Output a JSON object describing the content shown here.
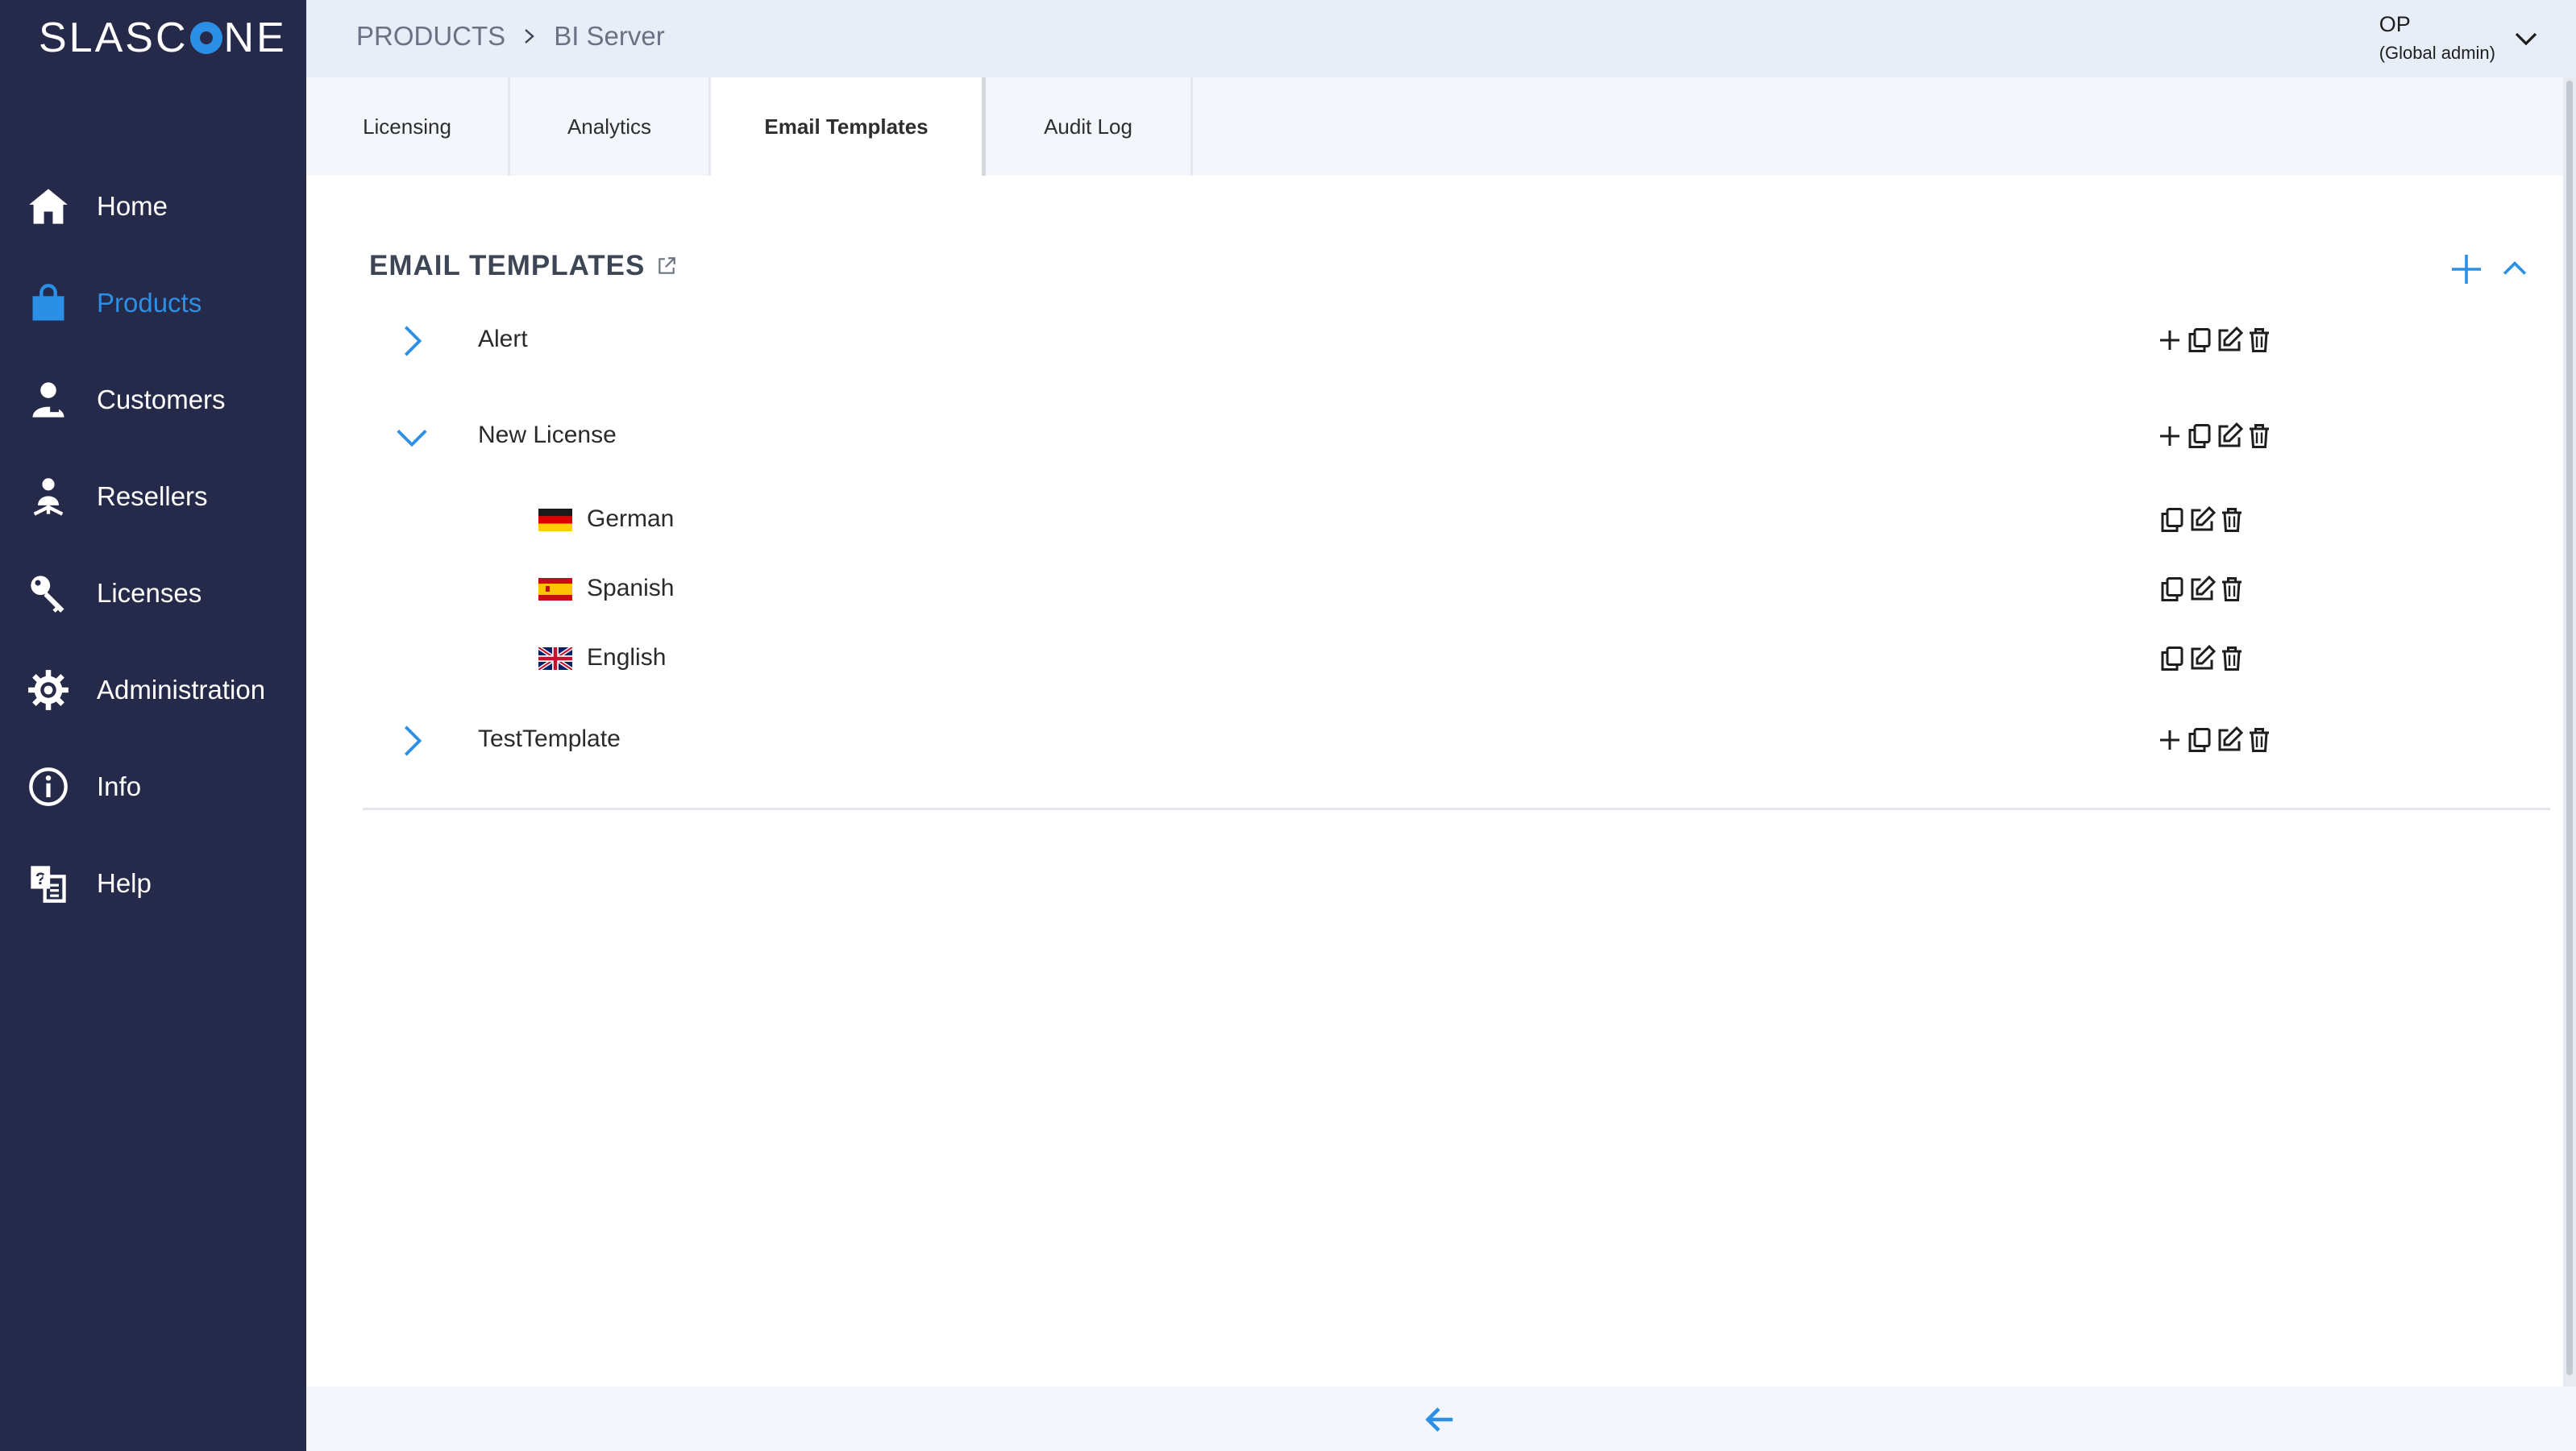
{
  "app": {
    "logo_left": "SLASC",
    "logo_right": "NE",
    "brand_color": "#2b8fe6",
    "sidebar_color": "#262a4a"
  },
  "sidebar": {
    "items": [
      {
        "label": "Home",
        "icon": "home-icon"
      },
      {
        "label": "Products",
        "icon": "shopping-bag-icon",
        "active": true
      },
      {
        "label": "Customers",
        "icon": "customer-icon"
      },
      {
        "label": "Resellers",
        "icon": "reseller-icon"
      },
      {
        "label": "Licenses",
        "icon": "key-icon"
      },
      {
        "label": "Administration",
        "icon": "gear-icon"
      },
      {
        "label": "Info",
        "icon": "info-icon"
      },
      {
        "label": "Help",
        "icon": "help-icon"
      }
    ]
  },
  "header": {
    "breadcrumb": [
      "PRODUCTS",
      "BI Server"
    ],
    "user_name": "OP",
    "user_role": "(Global admin)"
  },
  "tabs": [
    {
      "label": "Licensing"
    },
    {
      "label": "Analytics"
    },
    {
      "label": "Email Templates",
      "active": true
    },
    {
      "label": "Audit Log"
    }
  ],
  "main": {
    "section_title": "EMAIL TEMPLATES",
    "templates": [
      {
        "name": "Alert",
        "expanded": false
      },
      {
        "name": "New License",
        "expanded": true,
        "languages": [
          "German",
          "Spanish",
          "English"
        ]
      },
      {
        "name": "TestTemplate",
        "expanded": false
      }
    ]
  }
}
